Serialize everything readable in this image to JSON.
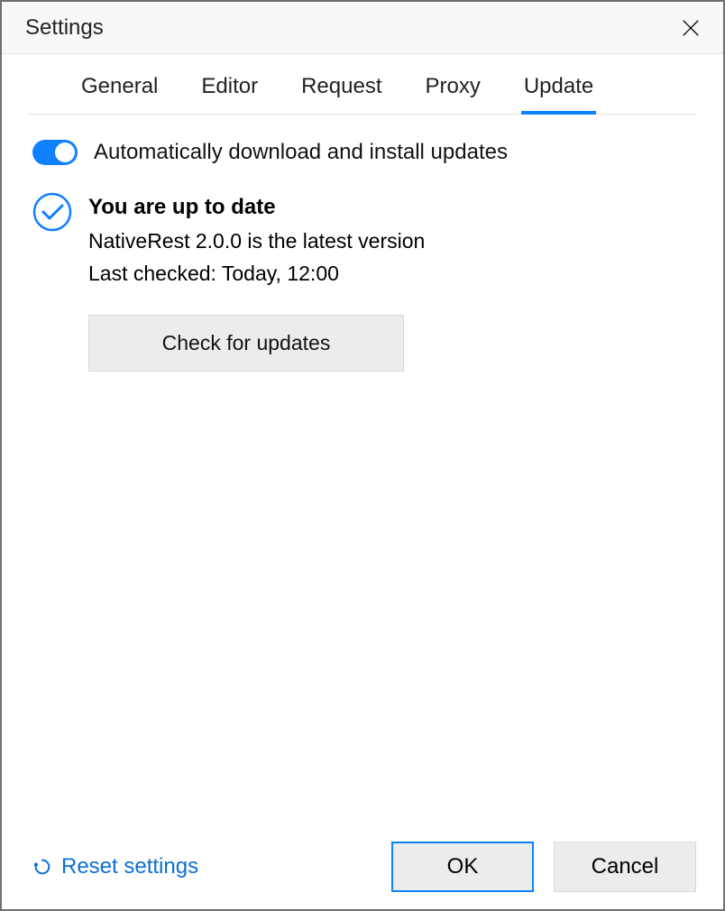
{
  "window": {
    "title": "Settings"
  },
  "tabs": [
    {
      "label": "General"
    },
    {
      "label": "Editor"
    },
    {
      "label": "Request"
    },
    {
      "label": "Proxy"
    },
    {
      "label": "Update",
      "active": true
    }
  ],
  "update": {
    "auto_label": "Automatically download and install updates",
    "status_heading": "You are up to date",
    "version_line": "NativeRest 2.0.0 is the latest version",
    "last_checked": "Last checked: Today, 12:00",
    "check_button": "Check for updates"
  },
  "footer": {
    "reset": "Reset settings",
    "ok": "OK",
    "cancel": "Cancel"
  },
  "colors": {
    "accent": "#0f80ff",
    "link": "#0d6fd6",
    "button_bg": "#ececec"
  }
}
